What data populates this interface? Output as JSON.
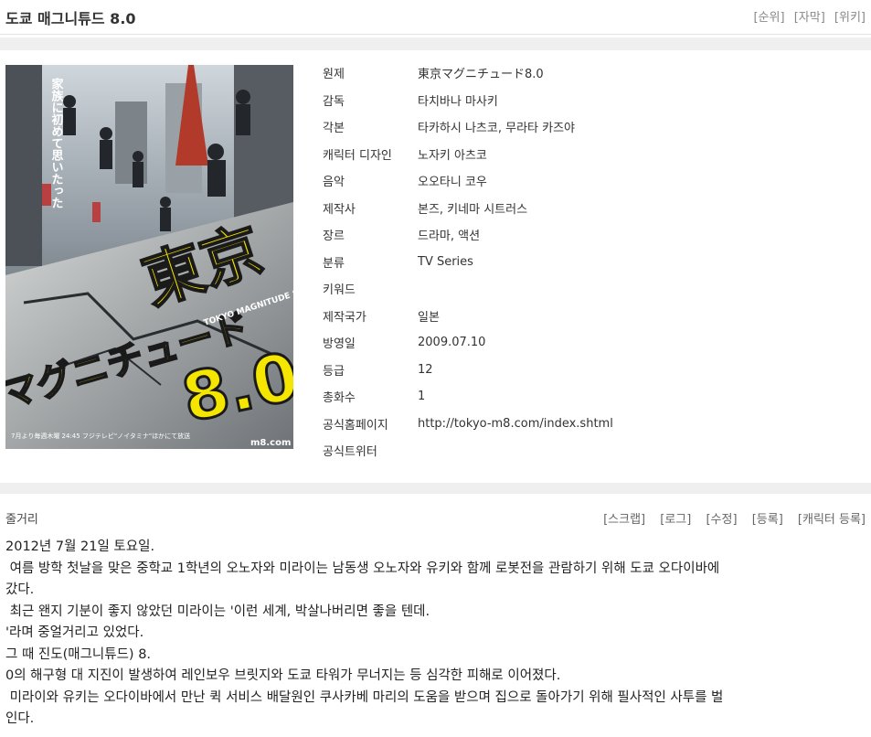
{
  "header": {
    "title": "도쿄 매그니튜드 8.0",
    "links": [
      "[순위]",
      "[자막]",
      "[위키]"
    ]
  },
  "poster": {
    "vertical_text": "家族に初めて思いたった",
    "logo_line1": "東京",
    "logo_line2": "マグニチュード",
    "logo_num": "8.0",
    "logo_sub": "TOKYO MAGNITUDE 8.0",
    "broadcast": "7月より毎週木曜 24:45 フジテレビ\"ノイタミナ\"ほかにて放送",
    "url_fragment": "m8.com"
  },
  "info": [
    {
      "label": "원제",
      "value": "東京マグニチュード8.0"
    },
    {
      "label": "감독",
      "value": "타치바나 마사키"
    },
    {
      "label": "각본",
      "value": "타카하시 나츠코, 무라타 카즈야"
    },
    {
      "label": "캐릭터 디자인",
      "value": "노자키 아츠코"
    },
    {
      "label": "음악",
      "value": "오오타니 코우"
    },
    {
      "label": "제작사",
      "value": "본즈, 키네마 시트러스"
    },
    {
      "label": "장르",
      "value": "드라마, 액션"
    },
    {
      "label": "분류",
      "value": "TV Series"
    },
    {
      "label": "키워드",
      "value": ""
    },
    {
      "label": "제작국가",
      "value": "일본"
    },
    {
      "label": "방영일",
      "value": "2009.07.10"
    },
    {
      "label": "등급",
      "value": "12"
    },
    {
      "label": "총화수",
      "value": "1"
    },
    {
      "label": "공식홈페이지",
      "value": "http://tokyo-m8.com/index.shtml"
    },
    {
      "label": "공식트위터",
      "value": ""
    }
  ],
  "synopsis": {
    "label": "줄거리",
    "links": [
      "[스크랩]",
      "[로그]",
      "[수정]",
      "[등록]",
      "[캐릭터 등록]"
    ],
    "lines": [
      "2012년 7월 21일 토요일.",
      " 여름 방학 첫날을 맞은 중학교 1학년의 오노자와 미라이는 남동생 오노자와 유키와 함께 로봇전을 관람하기 위해 도쿄 오다이바에",
      "갔다.",
      " 최근 왠지 기분이 좋지 않았던 미라이는 '이런 세계, 박살나버리면 좋을 텐데.",
      "'라며 중얼거리고 있었다.",
      "그 때 진도(매그니튜드) 8.",
      "0의 해구형 대 지진이 발생하여 레인보우 브릿지와 도쿄 타워가 무너지는 등 심각한 피해로 이어졌다.",
      " 미라이와 유키는 오다이바에서 만난 퀵 서비스 배달원인 쿠사카베 마리의 도움을 받으며 집으로 돌아가기 위해 필사적인 사투를 벌",
      "인다."
    ]
  }
}
